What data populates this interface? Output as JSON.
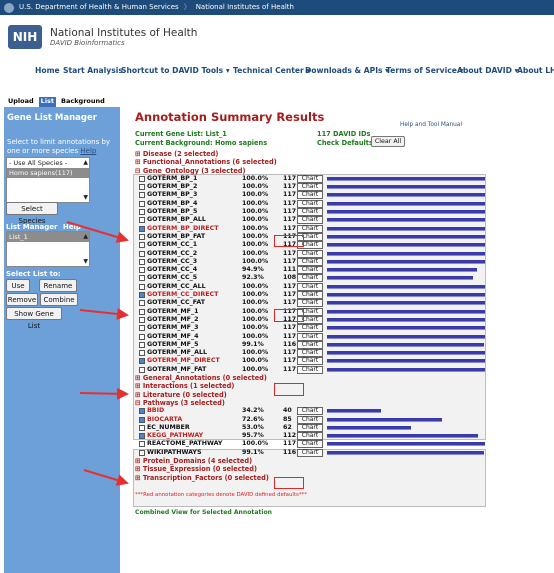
{
  "topbar": {
    "hhs": "U.S. Department of Health & Human Services",
    "nih": "National Institutes of Health"
  },
  "header": {
    "logo": "NIH",
    "title": "National Institutes of Health",
    "subtitle": "DAVID Bioinformatics"
  },
  "nav": [
    "Home",
    "Start Analysis",
    "Shortcut to DAVID Tools ▾",
    "Technical Center ▾",
    "Downloads & APIs ▾",
    "Terms of Service ▾",
    "About DAVID ▾",
    "About LHRI ▾"
  ],
  "tabs": [
    "Upload",
    "List",
    "Background"
  ],
  "sidebar": {
    "title": "Gene List Manager",
    "instruction": "Select to limit annotations by one or more species",
    "help": "Help",
    "species": [
      "- Use All Species -",
      "Homo sapiens(117)"
    ],
    "select_species": "Select Species",
    "list_manager": "List Manager",
    "list_help": "Help",
    "lists": [
      "List_1"
    ],
    "select_list_to": "Select List to:",
    "use": "Use",
    "rename": "Rename",
    "remove": "Remove",
    "combine": "Combine",
    "show_gene_list": "Show Gene List"
  },
  "main": {
    "title": "Annotation Summary Results",
    "help_manual": "Help and Tool Manual",
    "current_list": "Current Gene List: List_1",
    "david_ids": "117 DAVID IDs",
    "background": "Current Background: Homo sapiens",
    "check_defaults": "Check Defaults ☑",
    "clear_all": "Clear All",
    "disease": "⊞ Disease (2 selected)",
    "functional": "⊞ Functional_Annotations (6 selected)",
    "gene_ontology": "⊟ Gene_Ontology (3 selected)",
    "general": "⊞ General_Annotations (0 selected)",
    "interactions": "⊞ Interactions (1 selected)",
    "literature": "⊞ Literature (0 selected)",
    "pathways": "⊟ Pathways (3 selected)",
    "protein_domains": "⊞ Protein_Domains (4 selected)",
    "tissue": "⊞ Tissue_Expression (0 selected)",
    "transcription": "⊞ Transcription_Factors (0 selected)",
    "footnote": "***Red annotation categories denote DAVID defined defaults***",
    "combined": "Combined View for Selected Annotation",
    "chart_label": "Chart",
    "go_rows": [
      {
        "name": "GOTERM_BP_1",
        "pct": "100.0%",
        "count": "117",
        "checked": false,
        "red": false,
        "frac": 1.0
      },
      {
        "name": "GOTERM_BP_2",
        "pct": "100.0%",
        "count": "117",
        "checked": false,
        "red": false,
        "frac": 1.0
      },
      {
        "name": "GOTERM_BP_3",
        "pct": "100.0%",
        "count": "117",
        "checked": false,
        "red": false,
        "frac": 1.0
      },
      {
        "name": "GOTERM_BP_4",
        "pct": "100.0%",
        "count": "117",
        "checked": false,
        "red": false,
        "frac": 1.0
      },
      {
        "name": "GOTERM_BP_5",
        "pct": "100.0%",
        "count": "117",
        "checked": false,
        "red": false,
        "frac": 1.0
      },
      {
        "name": "GOTERM_BP_ALL",
        "pct": "100.0%",
        "count": "117",
        "checked": false,
        "red": false,
        "frac": 1.0
      },
      {
        "name": "GOTERM_BP_DIRECT",
        "pct": "100.0%",
        "count": "117",
        "checked": true,
        "red": true,
        "frac": 1.0
      },
      {
        "name": "GOTERM_BP_FAT",
        "pct": "100.0%",
        "count": "117",
        "checked": false,
        "red": false,
        "frac": 1.0
      },
      {
        "name": "GOTERM_CC_1",
        "pct": "100.0%",
        "count": "117",
        "checked": false,
        "red": false,
        "frac": 1.0
      },
      {
        "name": "GOTERM_CC_2",
        "pct": "100.0%",
        "count": "117",
        "checked": false,
        "red": false,
        "frac": 1.0
      },
      {
        "name": "GOTERM_CC_3",
        "pct": "100.0%",
        "count": "117",
        "checked": false,
        "red": false,
        "frac": 1.0
      },
      {
        "name": "GOTERM_CC_4",
        "pct": "94.9%",
        "count": "111",
        "checked": false,
        "red": false,
        "frac": 0.949
      },
      {
        "name": "GOTERM_CC_5",
        "pct": "92.3%",
        "count": "108",
        "checked": false,
        "red": false,
        "frac": 0.923
      },
      {
        "name": "GOTERM_CC_ALL",
        "pct": "100.0%",
        "count": "117",
        "checked": false,
        "red": false,
        "frac": 1.0
      },
      {
        "name": "GOTERM_CC_DIRECT",
        "pct": "100.0%",
        "count": "117",
        "checked": true,
        "red": true,
        "frac": 1.0
      },
      {
        "name": "GOTERM_CC_FAT",
        "pct": "100.0%",
        "count": "117",
        "checked": false,
        "red": false,
        "frac": 1.0
      },
      {
        "name": "GOTERM_MF_1",
        "pct": "100.0%",
        "count": "117",
        "checked": false,
        "red": false,
        "frac": 1.0
      },
      {
        "name": "GOTERM_MF_2",
        "pct": "100.0%",
        "count": "117",
        "checked": false,
        "red": false,
        "frac": 1.0
      },
      {
        "name": "GOTERM_MF_3",
        "pct": "100.0%",
        "count": "117",
        "checked": false,
        "red": false,
        "frac": 1.0
      },
      {
        "name": "GOTERM_MF_4",
        "pct": "100.0%",
        "count": "117",
        "checked": false,
        "red": false,
        "frac": 1.0
      },
      {
        "name": "GOTERM_MF_5",
        "pct": "99.1%",
        "count": "116",
        "checked": false,
        "red": false,
        "frac": 0.991
      },
      {
        "name": "GOTERM_MF_ALL",
        "pct": "100.0%",
        "count": "117",
        "checked": false,
        "red": false,
        "frac": 1.0
      },
      {
        "name": "GOTERM_MF_DIRECT",
        "pct": "100.0%",
        "count": "117",
        "checked": true,
        "red": true,
        "frac": 1.0
      },
      {
        "name": "GOTERM_MF_FAT",
        "pct": "100.0%",
        "count": "117",
        "checked": false,
        "red": false,
        "frac": 1.0
      }
    ],
    "pw_rows": [
      {
        "name": "BBID",
        "pct": "34.2%",
        "count": "40",
        "checked": true,
        "red": true,
        "frac": 0.342
      },
      {
        "name": "BIOCARTA",
        "pct": "72.6%",
        "count": "85",
        "checked": true,
        "red": true,
        "frac": 0.726
      },
      {
        "name": "EC_NUMBER",
        "pct": "53.0%",
        "count": "62",
        "checked": false,
        "red": false,
        "frac": 0.53
      },
      {
        "name": "KEGG_PATHWAY",
        "pct": "95.7%",
        "count": "112",
        "checked": true,
        "red": true,
        "frac": 0.957
      },
      {
        "name": "REACTOME_PATHWAY",
        "pct": "100.0%",
        "count": "117",
        "checked": false,
        "red": false,
        "frac": 1.0
      },
      {
        "name": "WIKIPATHWAYS",
        "pct": "99.1%",
        "count": "116",
        "checked": false,
        "red": false,
        "frac": 0.991
      }
    ]
  }
}
